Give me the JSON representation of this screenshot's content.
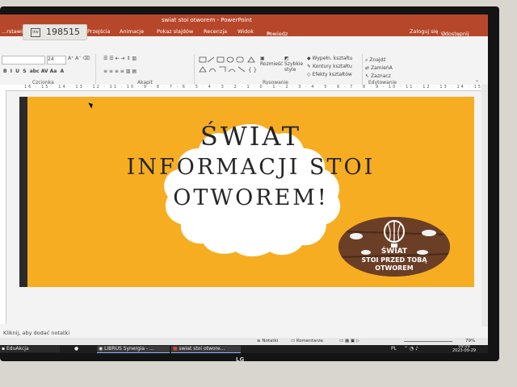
{
  "window": {
    "title": "swiat stoi otworem - PowerPoint",
    "tabs": [
      "...rstawianie",
      "Przejścia",
      "Animacje",
      "Pokaz slajdów",
      "Recenzja",
      "Widok"
    ],
    "tell_me": "Powiedz mi, co chcesz zrobić...",
    "sign_in": "Zaloguj się",
    "share": "Udostępnij"
  },
  "sticker": {
    "number": "198515"
  },
  "ribbon": {
    "font_size": "24",
    "groups": {
      "font": "Czcionka",
      "paragraph": "Akapit",
      "drawing": "Rysowanie",
      "editing": "Edytowanie"
    },
    "drawing": {
      "arrange": "Rozmieść",
      "quick_styles": "Szybkie style",
      "shape_fill": "Wypełn. kształtu",
      "shape_outline": "Kontury kształtu",
      "shape_effects": "Efekty kształtów"
    },
    "editing": {
      "find": "Znajdź",
      "replace": "ZamieńA",
      "select": "Zaznacz"
    }
  },
  "ruler": {
    "ticks": [
      "16",
      "15",
      "14",
      "13",
      "12",
      "11",
      "10",
      "9",
      "8",
      "7",
      "6",
      "5",
      "4",
      "3",
      "2",
      "1",
      "0",
      "1",
      "2",
      "3",
      "4",
      "5",
      "6",
      "7",
      "8",
      "9",
      "10",
      "11",
      "12",
      "13",
      "14",
      "15",
      "16"
    ]
  },
  "slide": {
    "headline": [
      "ŚWIAT",
      "INFORMACJI STOI",
      "OTWOREM!"
    ],
    "badge": [
      "ŚWIAT",
      "STOI PRZED TOBĄ",
      "OTWOREM"
    ]
  },
  "notes": {
    "placeholder": "Kliknij, aby dodać notatki"
  },
  "status": {
    "notes_btn": "Notatki",
    "comments_btn": "Komentarze",
    "zoom": "79%"
  },
  "taskbar": {
    "items": [
      "EduAkcja",
      "LIBRUS Synergia - ...",
      "swiat stoi otwore..."
    ],
    "lang": "PL",
    "time": "09:09",
    "date": "2023-09-29"
  },
  "monitor": {
    "brand": "LG"
  },
  "colors": {
    "accent": "#b7472a",
    "slide_bg": "#f7ad22",
    "text": "#262626",
    "badge": "#5a3420"
  }
}
